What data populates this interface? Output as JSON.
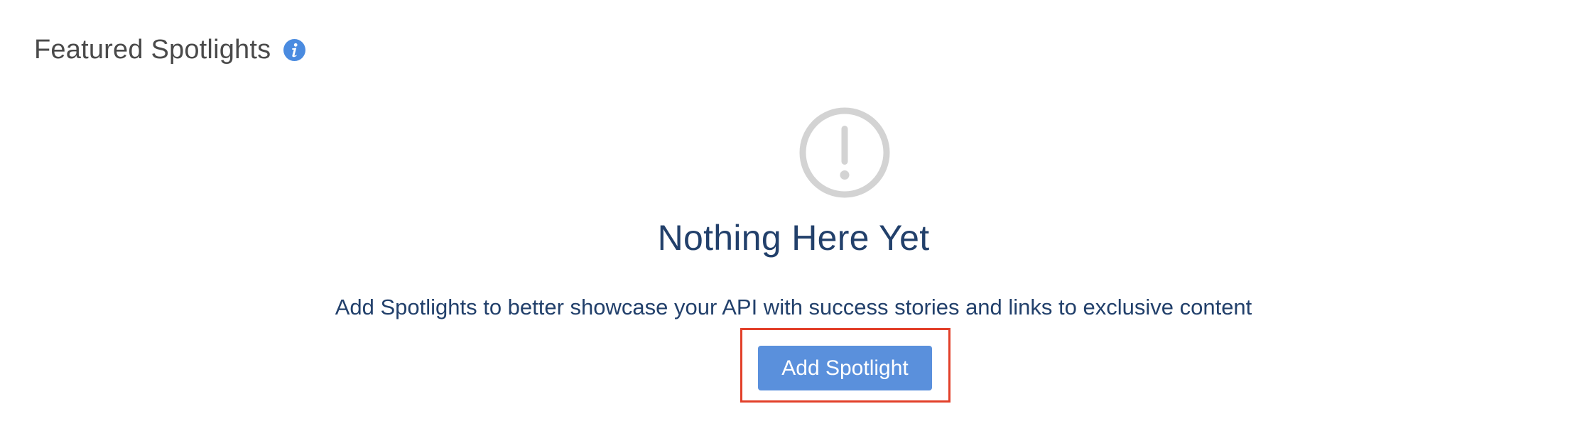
{
  "header": {
    "title": "Featured Spotlights",
    "info_icon": "info-icon"
  },
  "empty_state": {
    "icon": "exclamation-circle-icon",
    "title": "Nothing Here Yet",
    "description": "Add Spotlights to better showcase your API with success stories and links to exclusive content",
    "button_label": "Add Spotlight"
  },
  "colors": {
    "heading_text": "#4a4a4a",
    "info_icon": "#4a8be0",
    "empty_icon": "#d3d3d3",
    "empty_text": "#22406b",
    "button_bg": "#5a90dc",
    "button_text": "#ffffff",
    "highlight_border": "#e2402a"
  }
}
